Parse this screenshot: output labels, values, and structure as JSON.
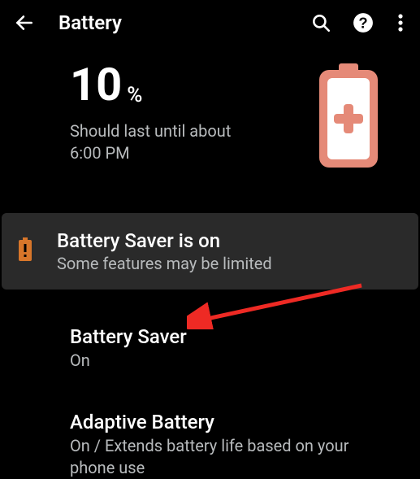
{
  "topbar": {
    "title": "Battery"
  },
  "battery": {
    "percent_value": "10",
    "percent_sign": "%",
    "estimate_line1": "Should last until about",
    "estimate_line2": "6:00 PM"
  },
  "banner": {
    "title": "Battery Saver is on",
    "subtitle": "Some features may be limited"
  },
  "items": [
    {
      "title": "Battery Saver",
      "subtitle": "On"
    },
    {
      "title": "Adaptive Battery",
      "subtitle": "On / Extends battery life based on your phone use"
    }
  ],
  "colors": {
    "accent": "#e58a78",
    "warning": "#d8762a",
    "arrow": "#ee2a24"
  }
}
